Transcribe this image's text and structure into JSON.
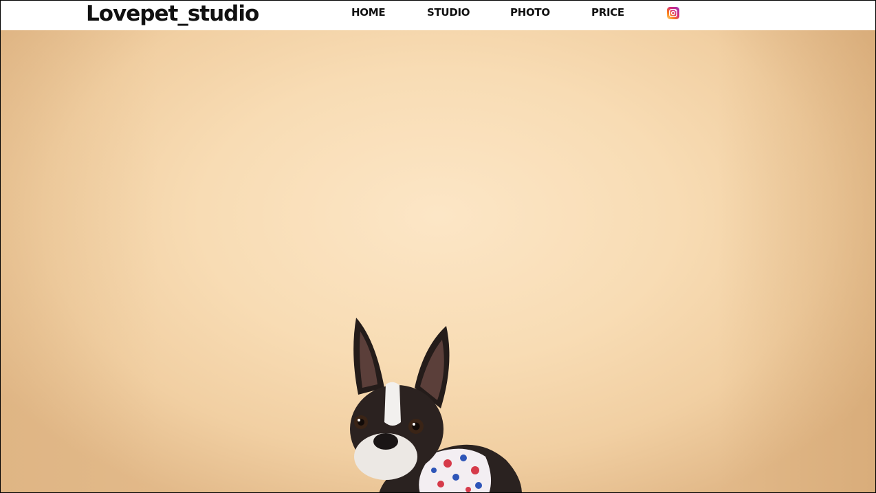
{
  "header": {
    "logo": "Lovepet_studio",
    "nav": {
      "home": "HOME",
      "studio": "STUDIO",
      "photo": "PHOTO",
      "price": "PRICE"
    },
    "social_icon": "instagram-icon"
  },
  "hero": {
    "image": "boston-terrier-dog-photo",
    "background_color": "#f8dcb4"
  }
}
